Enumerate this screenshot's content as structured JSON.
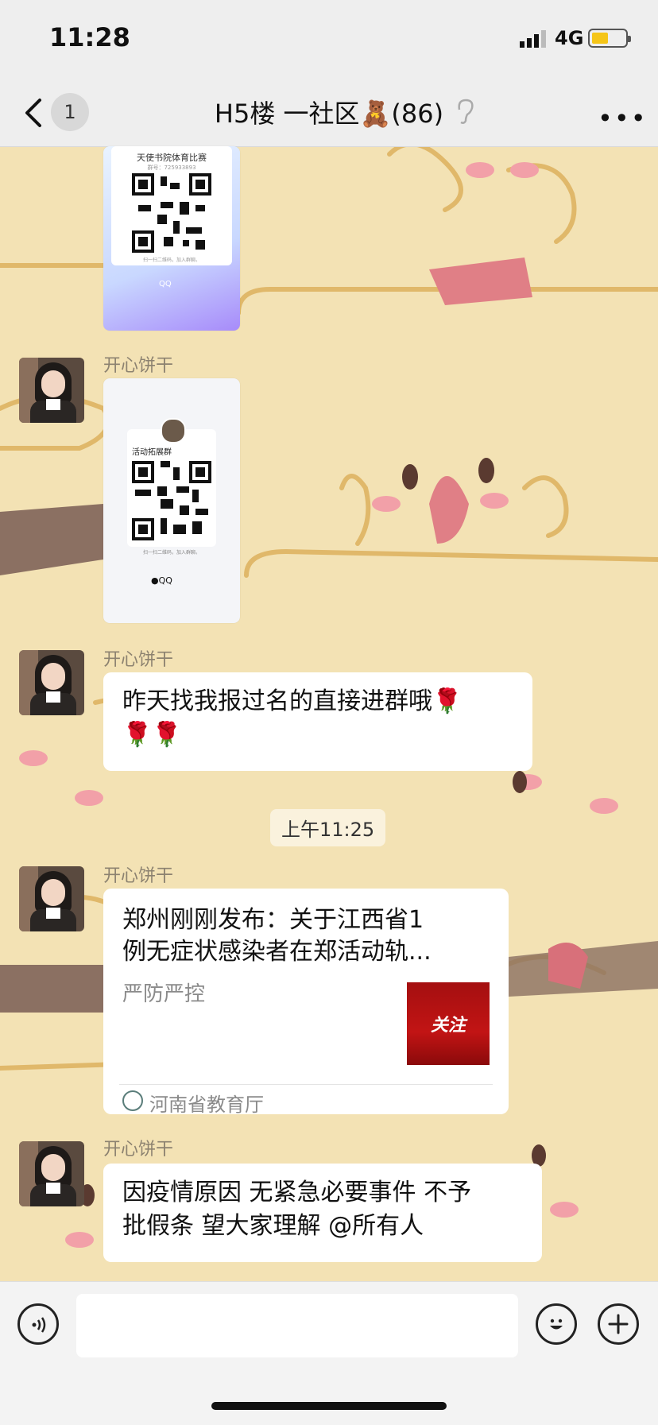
{
  "status_bar": {
    "time": "11:28",
    "network": "4G"
  },
  "header": {
    "unread_count": "1",
    "title": "H5楼 一社区🧸(86)"
  },
  "messages": [
    {
      "type": "qr_card",
      "card_title": "天使书院体育比赛",
      "card_sub": "群号：725933893",
      "hint": "扫一扫二维码，加入群聊。",
      "brand": "QQ"
    },
    {
      "type": "qr_card",
      "sender": "开心饼干",
      "card_title": "活动拓展群",
      "hint": "扫一扫二维码，加入群聊。",
      "brand": "QQ"
    },
    {
      "type": "text",
      "sender": "开心饼干",
      "line1": "昨天找我报过名的直接进群哦🌹",
      "line2": "🌹🌹"
    },
    {
      "type": "timestamp",
      "text": "上午11:25"
    },
    {
      "type": "article",
      "sender": "开心饼干",
      "title_line1": "郑州刚刚发布：关于江西省1",
      "title_line2": "例无症状感染者在郑活动轨...",
      "desc": "严防严控",
      "thumb_text": "关注",
      "source": "河南省教育厅"
    },
    {
      "type": "text",
      "sender": "开心饼干",
      "line1": "因疫情原因 无紧急必要事件 不予",
      "line2": "批假条 望大家理解 @所有人"
    }
  ],
  "icons": {
    "back": "chevron-left-icon",
    "more": "more-dots-icon",
    "voice": "voice-icon",
    "emoji": "emoji-icon",
    "plus": "plus-icon",
    "ear": "ear-icon"
  },
  "colors": {
    "background": "#f3e2b4",
    "bar": "#eeeeee",
    "bubble": "#ffffff",
    "thumb": "#c21414"
  }
}
